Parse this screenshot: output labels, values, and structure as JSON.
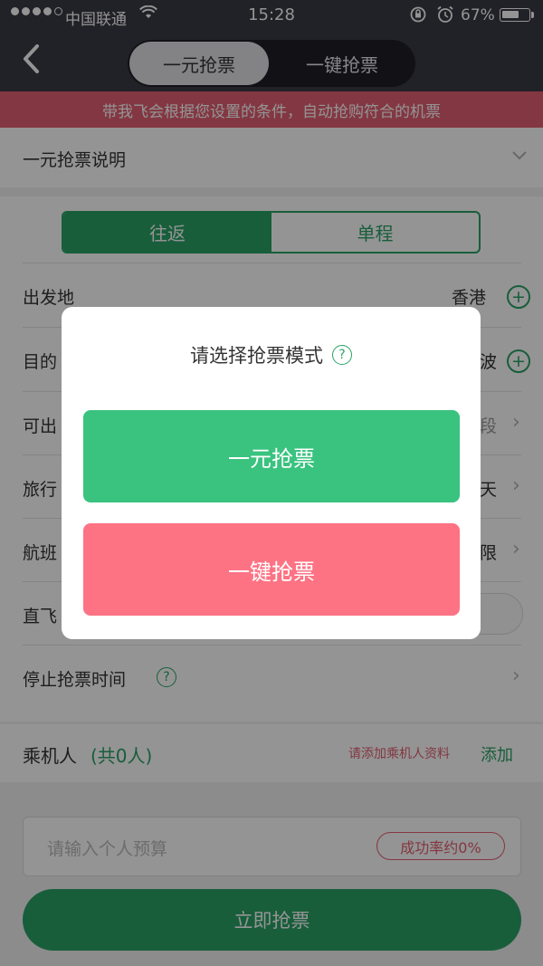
{
  "status": {
    "carrier": "中国联通",
    "time": "15:28",
    "battery_text": "67%",
    "battery_level": 0.67,
    "signal_bars": 4,
    "wifi_icon": "wifi-icon",
    "rotation_lock_icon": "rotation-lock-icon",
    "alarm_icon": "alarm-icon"
  },
  "nav": {
    "back_icon": "chevron-left-icon",
    "tabs": [
      {
        "label": "一元抢票",
        "selected": true
      },
      {
        "label": "一键抢票",
        "selected": false
      }
    ]
  },
  "banner": {
    "text": "带我飞会根据您设置的条件，自动抢购符合的机票"
  },
  "form": {
    "explain_label": "一元抢票说明",
    "trip_toggle": [
      {
        "label": "往返",
        "selected": true
      },
      {
        "label": "单程",
        "selected": false
      }
    ],
    "rows": [
      {
        "label": "出发地",
        "value": "香港"
      },
      {
        "label": "目的",
        "value": "波"
      },
      {
        "label": "可出",
        "value": "段"
      },
      {
        "label": "旅行",
        "value": "天"
      },
      {
        "label": "航班",
        "value": "限"
      },
      {
        "label": "直飞",
        "value": ""
      },
      {
        "label": "停止抢票时间",
        "value": ""
      }
    ],
    "passengers_label": "乘机人",
    "passengers_count": "(共0人)",
    "passengers_hint": "请添加乘机人资料",
    "add_label": "添加",
    "budget_placeholder": "请输入个人预算",
    "success_rate": "成功率约0%",
    "grab_button": "立即抢票"
  },
  "modal": {
    "title": "请选择抢票模式",
    "help_icon": "question-circle-icon",
    "option_one": "一元抢票",
    "option_two": "一键抢票"
  },
  "colors": {
    "nav_bg": "#3a3a46",
    "banner": "#e25f72",
    "green": "#2aa266",
    "modal_green": "#39c37f",
    "modal_pink": "#fd7384"
  }
}
